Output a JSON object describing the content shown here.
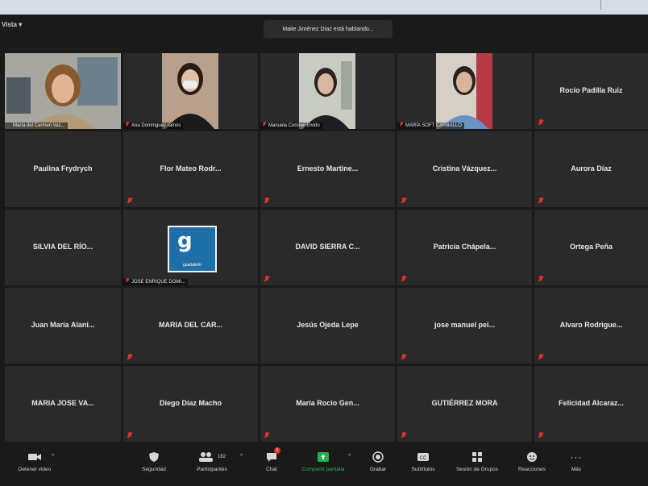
{
  "top_bar": {
    "view_label": "Vista ▾",
    "speaking_text": "Maite Jiménez Díaz está hablando..."
  },
  "video_tiles": [
    {
      "name": "María del Carmen Vaz..."
    },
    {
      "name": "Ana Domínguez ramos"
    },
    {
      "name": "Manuela Coronel Elvido"
    },
    {
      "name": "MARÍA SOFT CARBALLO"
    }
  ],
  "logo_tile": {
    "name": "JOSE ENRIQUE DOMI...",
    "logo_text": "guadalinfo"
  },
  "name_tiles": [
    "Rocío Padilla Ruiz",
    "Paulina Frydrych",
    "Flor Mateo Rodr...",
    "Ernesto Martine...",
    "Cristina Vázquez...",
    "Aurora Díaz",
    "SILVIA DEL RÍO...",
    "DAVID SIERRA C...",
    "Patricia Chápela...",
    "Ortega Peña",
    "Juan María Alani...",
    "MARIA DEL CAR...",
    "Jesús Ojeda Lepe",
    "jose manuel pei...",
    "Alvaro Rodrigue...",
    "MARIA JOSE VA...",
    "Diego Díaz Macho",
    "María Rocio Gen...",
    "GUTIÉRREZ MORA",
    "Felicidad Alcaraz..."
  ],
  "toolbar": {
    "stop_video": "Detener video",
    "security": "Seguridad",
    "participants": "Participantes",
    "participants_count": "182",
    "chat": "Chat",
    "chat_badge": "1",
    "share_screen": "Compartir pantalla",
    "record": "Grabar",
    "subtitles": "Subtítulos",
    "breakout": "Sesión de Grupos",
    "reactions": "Reacciones",
    "more": "Más"
  },
  "colors": {
    "share_green": "#22b14c",
    "mute_red": "#d9342b",
    "logo_blue": "#1e6fa8"
  }
}
